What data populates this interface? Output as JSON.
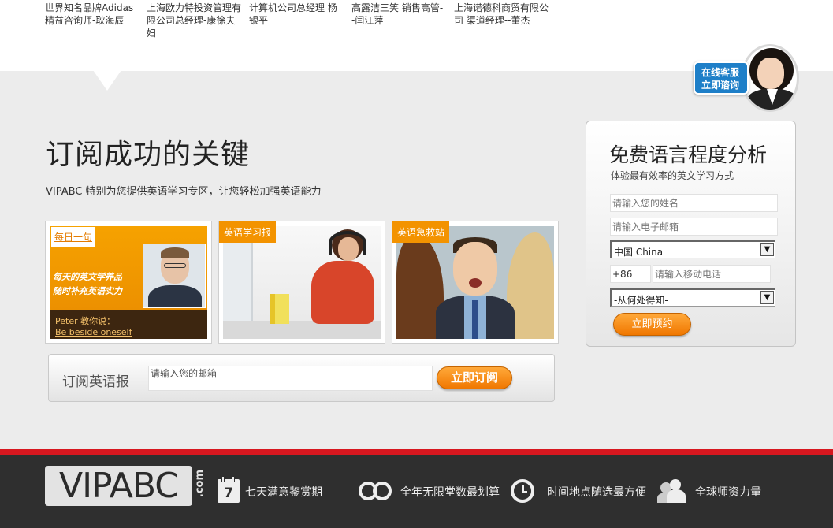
{
  "testimonials": [
    {
      "text": "世界知名品牌Adidas 精益咨询师-耿海辰"
    },
    {
      "text": "上海欧力特投资管理有限公司总经理-康徐夫妇"
    },
    {
      "text": "计算机公司总经理 杨银平"
    },
    {
      "text": "高露洁三笑 销售高管--闫江萍"
    },
    {
      "text": "上海诺德科商贸有限公司 渠道经理--董杰"
    }
  ],
  "online_service": {
    "line1": "在线客服",
    "line2": "立即谘询"
  },
  "main": {
    "title": "订阅成功的关键",
    "subtitle": "VIPABC 特别为您提供英语学习专区，让您轻松加强英语能力"
  },
  "cards": [
    {
      "tag": "每日一句",
      "calligraphy_1": "每天的英文学养品",
      "calligraphy_2": "随时补充英语实力",
      "teacher": "Peter 教你说：",
      "phrase": "Be beside oneself"
    },
    {
      "tag": "英语学习报"
    },
    {
      "tag": "英语急救站"
    }
  ],
  "subscribe": {
    "label": "订阅英语报",
    "email_placeholder": "请输入您的邮箱",
    "button": "立即订阅"
  },
  "form": {
    "title": "免费语言程度分析",
    "desc": "体验最有效率的英文学习方式",
    "name_placeholder": "请输入您的姓名",
    "email_placeholder": "请输入电子邮箱",
    "country_selected": "中国 China",
    "phone_prefix": "+86",
    "phone_placeholder": "请输入移动电话",
    "source_selected": "-从何处得知-",
    "submit": "立即预约"
  },
  "footer": {
    "logo": "VIPABC",
    "logo_suffix": ".com",
    "calendar_number": "7",
    "features": [
      "七天满意鉴赏期",
      "全年无限堂数最划算",
      "时间地点随选最方便",
      "全球师资力量"
    ]
  },
  "colors": {
    "accent": "#f39300",
    "footer_bg": "#2f2f2f",
    "footer_stripe": "#d7171f"
  }
}
